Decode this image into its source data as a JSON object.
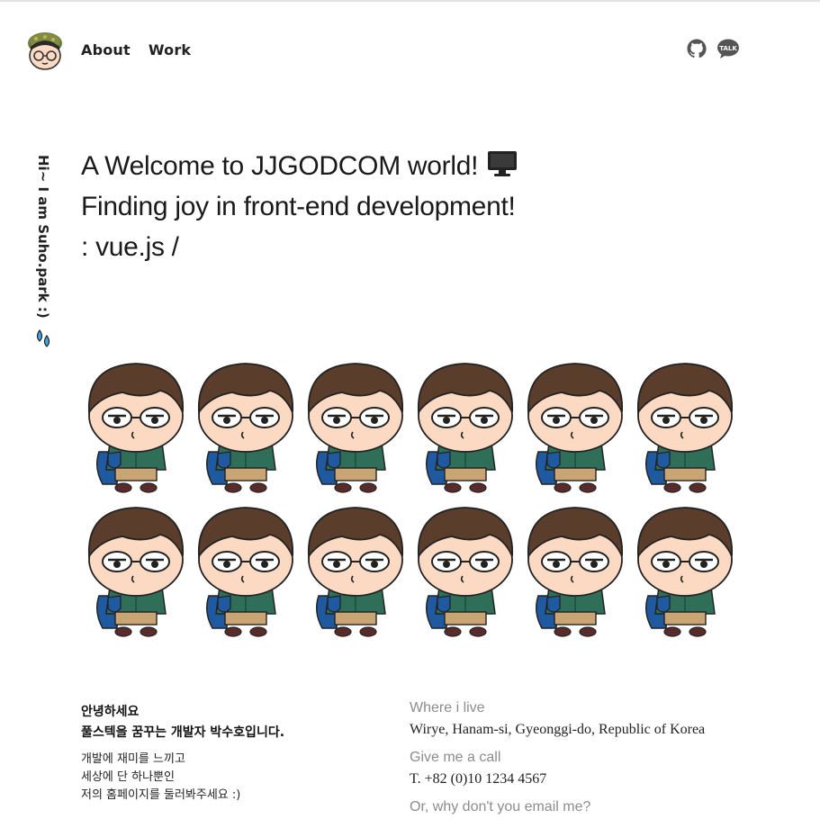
{
  "header": {
    "nav": [
      {
        "label": "About"
      },
      {
        "label": "Work"
      }
    ],
    "social": [
      "github-icon",
      "kakaotalk-icon"
    ],
    "kakao_badge": "TALK"
  },
  "side": {
    "greeting": "Hi~ I am Suho.park :)",
    "icon": "sweat-drops-icon"
  },
  "hero": {
    "line1": "A Welcome to JJGODCOM world!",
    "line1_icon": "monitor-icon",
    "line2": "Finding joy in front-end development!",
    "line3": ": vue.js /"
  },
  "characters": {
    "rows": 2,
    "per_row": 6,
    "icon": "chibi-character-illustration"
  },
  "intro": {
    "heading1": "안녕하세요",
    "heading2": "풀스텍을 꿈꾸는 개발자 박수호입니다.",
    "body": [
      "개발에 재미를 느끼고",
      "세상에 단 하나뿐인",
      "저의 홈페이지를 둘러봐주세요 :)"
    ]
  },
  "contact": {
    "live_label": "Where i live",
    "live_value": "Wirye, Hanam-si, Gyeonggi-do, Republic of Korea",
    "call_label": "Give me a call",
    "call_value": "T. +82 (0)10 1234 4567",
    "email_label": "Or, why don't you email me?"
  },
  "colors": {
    "text": "#1a1a1a",
    "muted": "#8c8c8c",
    "hair": "#5a3d2b",
    "skin": "#fbd9c2",
    "jacket": "#2f6e58",
    "pants": "#c9a574",
    "bag": "#1f5aa0",
    "logo_helmet": "#6b7a3a"
  }
}
